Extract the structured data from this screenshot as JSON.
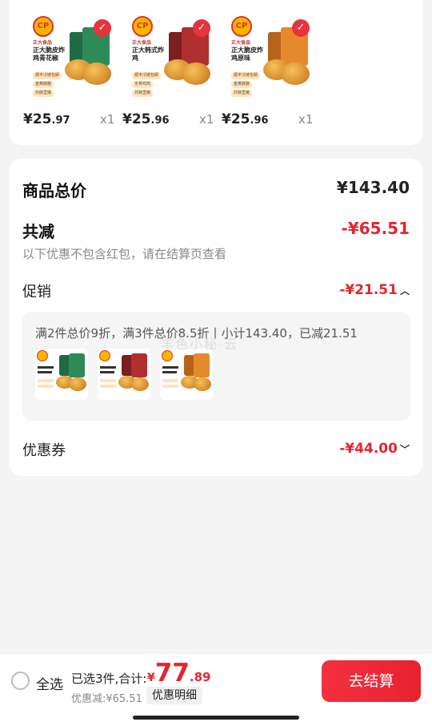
{
  "products": [
    {
      "brand": "正大食品",
      "name": "正大脆皮炸鸡青花椒",
      "tags": [
        "顺丰冷链包邮",
        "金黄酥脆",
        "外酥里嫩"
      ],
      "price_int": "¥25",
      "price_dec": ".97",
      "qty": "x1",
      "pack_color": "#2e8b57",
      "accent": "#1f6b45"
    },
    {
      "brand": "正大食品",
      "name": "正大韩式炸鸡",
      "tags": [
        "顺丰冷链包邮",
        "无骨鸡肉",
        "外酥里嫩"
      ],
      "price_int": "¥25",
      "price_dec": ".96",
      "qty": "x1",
      "pack_color": "#b03030",
      "accent": "#7b1f1f"
    },
    {
      "brand": "正大食品",
      "name": "正大脆皮炸鸡原味",
      "tags": [
        "顺丰冷链包邮",
        "金黄酥脆",
        "外酥里嫩"
      ],
      "price_int": "¥25",
      "price_dec": ".96",
      "qty": "x1",
      "pack_color": "#e58a2c",
      "accent": "#b8631a"
    }
  ],
  "summary": {
    "goods_total_label": "商品总价",
    "goods_total_value": "¥143.40",
    "reduce_label": "共减",
    "reduce_value": "-¥65.51",
    "reduce_note": "以下优惠不包含红包，请在结算页查看",
    "promo_label": "促销",
    "promo_value": "-¥21.51",
    "promo_desc": "满2件总价9折，满3件总价8.5折丨小计143.40，已减21.51",
    "coupon_label": "优惠券",
    "coupon_value": "-¥44.00"
  },
  "watermark": "丰色小秘·云",
  "bottom": {
    "select_all": "全选",
    "selected_count": "已选3件,合计:",
    "total_yen": "¥",
    "total_int": "77",
    "total_dec": ".89",
    "saved": "优惠减:¥65.51",
    "detail_button": "优惠明细",
    "checkout_button": "去结算"
  },
  "icons": {
    "check": "check-icon",
    "chevron": "chevron-down-icon",
    "radio": "radio-unchecked-icon"
  },
  "colors": {
    "accent_red": "#e3262f",
    "checkout_red": "#f5303e"
  }
}
